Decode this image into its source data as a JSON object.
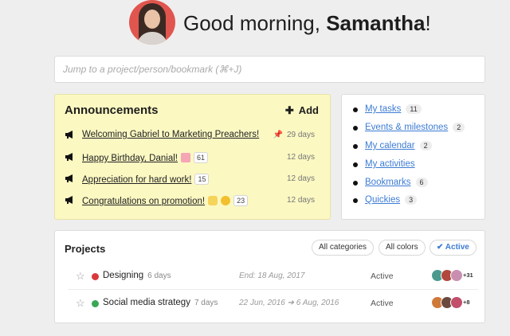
{
  "greeting": {
    "prefix": "Good morning, ",
    "name": "Samantha",
    "suffix": "!"
  },
  "search": {
    "placeholder": "Jump to a project/person/bookmark (⌘+J)"
  },
  "announcements": {
    "title": "Announcements",
    "add_label": "Add",
    "items": [
      {
        "text": "Welcoming Gabriel to Marketing Preachers!",
        "days": "29 days",
        "pinned": true
      },
      {
        "text": "Happy Birthday, Danial!",
        "emoji": "cake-emoji",
        "badge": "61",
        "days": "12 days"
      },
      {
        "text": "Appreciation for hard work!",
        "badge": "15",
        "days": "12 days"
      },
      {
        "text": "Congratulations on promotion!",
        "emoji": "clap-emoji",
        "emoji2": "grin-emoji",
        "badge": "23",
        "days": "12 days"
      }
    ]
  },
  "quick_links": [
    {
      "label": "My tasks",
      "count": "11"
    },
    {
      "label": "Events & milestones",
      "count": "2"
    },
    {
      "label": "My calendar",
      "count": "2"
    },
    {
      "label": "My activities",
      "count": ""
    },
    {
      "label": "Bookmarks",
      "count": "6"
    },
    {
      "label": "Quickies",
      "count": "3"
    }
  ],
  "projects": {
    "title": "Projects",
    "filters": [
      "All categories",
      "All colors",
      "Active"
    ],
    "rows": [
      {
        "name": "Designing",
        "days": "6 days",
        "date": "End: 18 Aug, 2017",
        "status": "Active",
        "color": "#d8393c",
        "more": "+31"
      },
      {
        "name": "Social media strategy",
        "days": "7 days",
        "date": "22 Jun, 2016 ➔ 6 Aug, 2016",
        "status": "Active",
        "color": "#3aa757",
        "more": "+8"
      }
    ]
  },
  "colors": {
    "accent": "#3d7cd4",
    "announcement_bg": "#fbf8c2"
  }
}
